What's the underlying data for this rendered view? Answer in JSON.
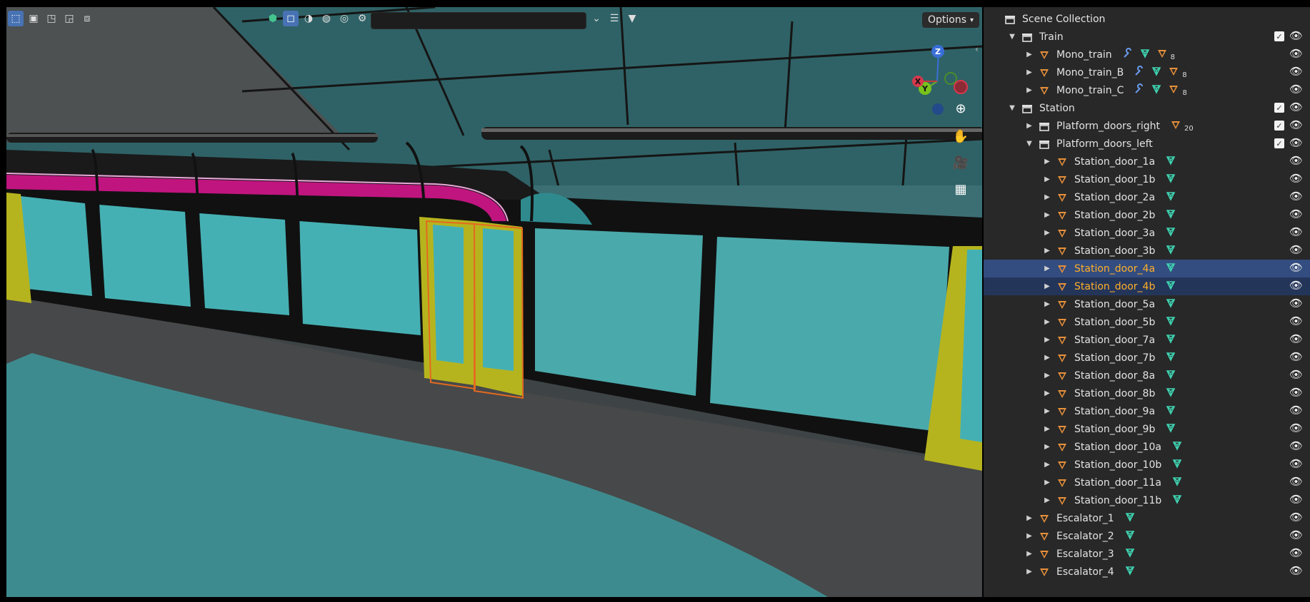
{
  "viewport": {
    "search": {
      "value": "",
      "placeholder": ""
    },
    "options_label": "Options",
    "gizmo": {
      "z": "Z",
      "y": "Y",
      "x": "X"
    }
  },
  "outliner": {
    "rows": [
      {
        "label": "Scene Collection",
        "indent": 0,
        "type": "scene",
        "arrow": "",
        "selected": false
      },
      {
        "label": "Train",
        "indent": 1,
        "type": "collection",
        "arrow": "down",
        "check": true,
        "selected": false
      },
      {
        "label": "Mono_train",
        "indent": 2,
        "type": "object",
        "arrow": "right",
        "mods": [
          "wrench",
          "mesh",
          "tri"
        ],
        "count": "8",
        "selected": false
      },
      {
        "label": "Mono_train_B",
        "indent": 2,
        "type": "object",
        "arrow": "right",
        "mods": [
          "wrench",
          "mesh",
          "tri"
        ],
        "count": "8",
        "selected": false
      },
      {
        "label": "Mono_train_C",
        "indent": 2,
        "type": "object",
        "arrow": "right",
        "mods": [
          "wrench",
          "mesh",
          "tri"
        ],
        "count": "8",
        "selected": false
      },
      {
        "label": "Station",
        "indent": 1,
        "type": "collection",
        "arrow": "down",
        "check": true,
        "selected": false
      },
      {
        "label": "Platform_doors_right",
        "indent": 2,
        "type": "collection",
        "arrow": "right",
        "mods": [
          "tri"
        ],
        "count": "20",
        "check": true,
        "selected": false
      },
      {
        "label": "Platform_doors_left",
        "indent": 2,
        "type": "collection",
        "arrow": "down",
        "check": true,
        "selected": false
      },
      {
        "label": "Station_door_1a",
        "indent": 3,
        "type": "object",
        "arrow": "right",
        "mods": [
          "mesh"
        ],
        "selected": false
      },
      {
        "label": "Station_door_1b",
        "indent": 3,
        "type": "object",
        "arrow": "right",
        "mods": [
          "mesh"
        ],
        "selected": false
      },
      {
        "label": "Station_door_2a",
        "indent": 3,
        "type": "object",
        "arrow": "right",
        "mods": [
          "mesh"
        ],
        "selected": false
      },
      {
        "label": "Station_door_2b",
        "indent": 3,
        "type": "object",
        "arrow": "right",
        "mods": [
          "mesh"
        ],
        "selected": false
      },
      {
        "label": "Station_door_3a",
        "indent": 3,
        "type": "object",
        "arrow": "right",
        "mods": [
          "mesh"
        ],
        "selected": false
      },
      {
        "label": "Station_door_3b",
        "indent": 3,
        "type": "object",
        "arrow": "right",
        "mods": [
          "mesh"
        ],
        "selected": false
      },
      {
        "label": "Station_door_4a",
        "indent": 3,
        "type": "object",
        "arrow": "right",
        "mods": [
          "mesh"
        ],
        "selected": "active"
      },
      {
        "label": "Station_door_4b",
        "indent": 3,
        "type": "object",
        "arrow": "right",
        "mods": [
          "mesh"
        ],
        "selected": "selected"
      },
      {
        "label": "Station_door_5a",
        "indent": 3,
        "type": "object",
        "arrow": "right",
        "mods": [
          "mesh"
        ],
        "selected": false
      },
      {
        "label": "Station_door_5b",
        "indent": 3,
        "type": "object",
        "arrow": "right",
        "mods": [
          "mesh"
        ],
        "selected": false
      },
      {
        "label": "Station_door_7a",
        "indent": 3,
        "type": "object",
        "arrow": "right",
        "mods": [
          "mesh"
        ],
        "selected": false
      },
      {
        "label": "Station_door_7b",
        "indent": 3,
        "type": "object",
        "arrow": "right",
        "mods": [
          "mesh"
        ],
        "selected": false
      },
      {
        "label": "Station_door_8a",
        "indent": 3,
        "type": "object",
        "arrow": "right",
        "mods": [
          "mesh"
        ],
        "selected": false
      },
      {
        "label": "Station_door_8b",
        "indent": 3,
        "type": "object",
        "arrow": "right",
        "mods": [
          "mesh"
        ],
        "selected": false
      },
      {
        "label": "Station_door_9a",
        "indent": 3,
        "type": "object",
        "arrow": "right",
        "mods": [
          "mesh"
        ],
        "selected": false
      },
      {
        "label": "Station_door_9b",
        "indent": 3,
        "type": "object",
        "arrow": "right",
        "mods": [
          "mesh"
        ],
        "selected": false
      },
      {
        "label": "Station_door_10a",
        "indent": 3,
        "type": "object",
        "arrow": "right",
        "mods": [
          "mesh"
        ],
        "selected": false
      },
      {
        "label": "Station_door_10b",
        "indent": 3,
        "type": "object",
        "arrow": "right",
        "mods": [
          "mesh"
        ],
        "selected": false
      },
      {
        "label": "Station_door_11a",
        "indent": 3,
        "type": "object",
        "arrow": "right",
        "mods": [
          "mesh"
        ],
        "selected": false
      },
      {
        "label": "Station_door_11b",
        "indent": 3,
        "type": "object",
        "arrow": "right",
        "mods": [
          "mesh"
        ],
        "selected": false
      },
      {
        "label": "Escalator_1",
        "indent": 2,
        "type": "object",
        "arrow": "right",
        "mods": [
          "mesh"
        ],
        "selected": false
      },
      {
        "label": "Escalator_2",
        "indent": 2,
        "type": "object",
        "arrow": "right",
        "mods": [
          "mesh"
        ],
        "selected": false
      },
      {
        "label": "Escalator_3",
        "indent": 2,
        "type": "object",
        "arrow": "right",
        "mods": [
          "mesh"
        ],
        "selected": false
      },
      {
        "label": "Escalator_4",
        "indent": 2,
        "type": "object",
        "arrow": "right",
        "mods": [
          "mesh"
        ],
        "selected": false
      }
    ]
  },
  "colors": {
    "selection_active": "#334d80",
    "selection": "#24355a",
    "active_label": "#ffaf29",
    "object_icon": "#e8903a",
    "mesh_icon": "#3fd2b0",
    "modifier_icon": "#6a9cf0"
  }
}
